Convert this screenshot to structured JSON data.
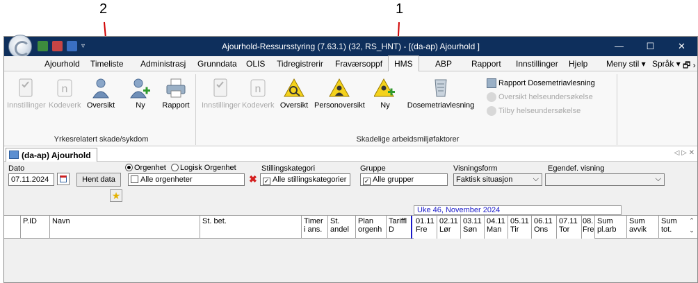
{
  "annotations": {
    "label_1": "1",
    "label_2": "2"
  },
  "window": {
    "title": "Ajourhold-Ressursstyring (7.63.1) (32, RS_HNT) - [(da-ap) Ajourhold ]",
    "controls": {
      "minimize": "—",
      "maximize": "☐",
      "close": "✕"
    }
  },
  "menu": {
    "items": [
      "Ajourhold",
      "Timeliste",
      "Administrasj",
      "Grunndata",
      "OLIS",
      "Tidregistrerir",
      "Fraværsoppf",
      "HMS",
      "ABP",
      "Rapport",
      "Innstillinger",
      "Hjelp"
    ],
    "active": "HMS",
    "right": [
      "Meny stil ▾",
      "Språk ▾",
      "🗗 ›"
    ]
  },
  "ribbon": {
    "group1": {
      "label": "Yrkesrelatert skade/sykdom",
      "buttons": [
        "Innstillinger",
        "Kodeverk",
        "Oversikt",
        "Ny",
        "Rapport"
      ]
    },
    "group2": {
      "label": "Skadelige arbeidsmiljøfaktorer",
      "buttons": [
        "Innstillinger",
        "Kodeverk",
        "Oversikt",
        "Personoversikt",
        "Ny",
        "Dosemetriavlesning"
      ],
      "small_buttons": [
        "Rapport Dosemetriavlesning",
        "Oversikt helseundersøkelse",
        "Tilby helseundersøkelse"
      ]
    }
  },
  "doc_tab": {
    "label": "(da-ap) Ajourhold",
    "nav": "◁ ▷ ✕"
  },
  "filters": {
    "dato_label": "Dato",
    "dato_value": "07.11.2024",
    "hent_data": "Hent data",
    "org_radio_1": "Orgenhet",
    "org_radio_2": "Logisk Orgenhet",
    "alle_orgenheter": "Alle orgenheter",
    "stillingskategori_label": "Stillingskategori",
    "alle_stillingskategorier": "Alle stillingskategorier",
    "gruppe_label": "Gruppe",
    "alle_grupper": "Alle grupper",
    "visningsform_label": "Visningsform",
    "visningsform_value": "Faktisk situasjon",
    "egendef_label": "Egendef. visning",
    "egendef_value": ""
  },
  "grid": {
    "week_label": "Uke 46, November 2024",
    "columns": {
      "pid": "P.ID",
      "navn": "Navn",
      "stbet": "St. bet.",
      "timer": "Timer i ans.",
      "st_andel": "St. andel",
      "plan": "Plan orgenh",
      "tariff": "Tariffl D",
      "days": [
        [
          "01.11",
          "Fre"
        ],
        [
          "02.11",
          "Lør"
        ],
        [
          "03.11",
          "Søn"
        ],
        [
          "04.11",
          "Man"
        ],
        [
          "05.11",
          "Tir"
        ],
        [
          "06.11",
          "Ons"
        ],
        [
          "07.11",
          "Tor"
        ],
        [
          "08.",
          "Fre"
        ]
      ],
      "sum_plarb": "Sum pl.arb",
      "sum_avvik": "Sum avvik",
      "sum_tot": "Sum tot."
    }
  }
}
